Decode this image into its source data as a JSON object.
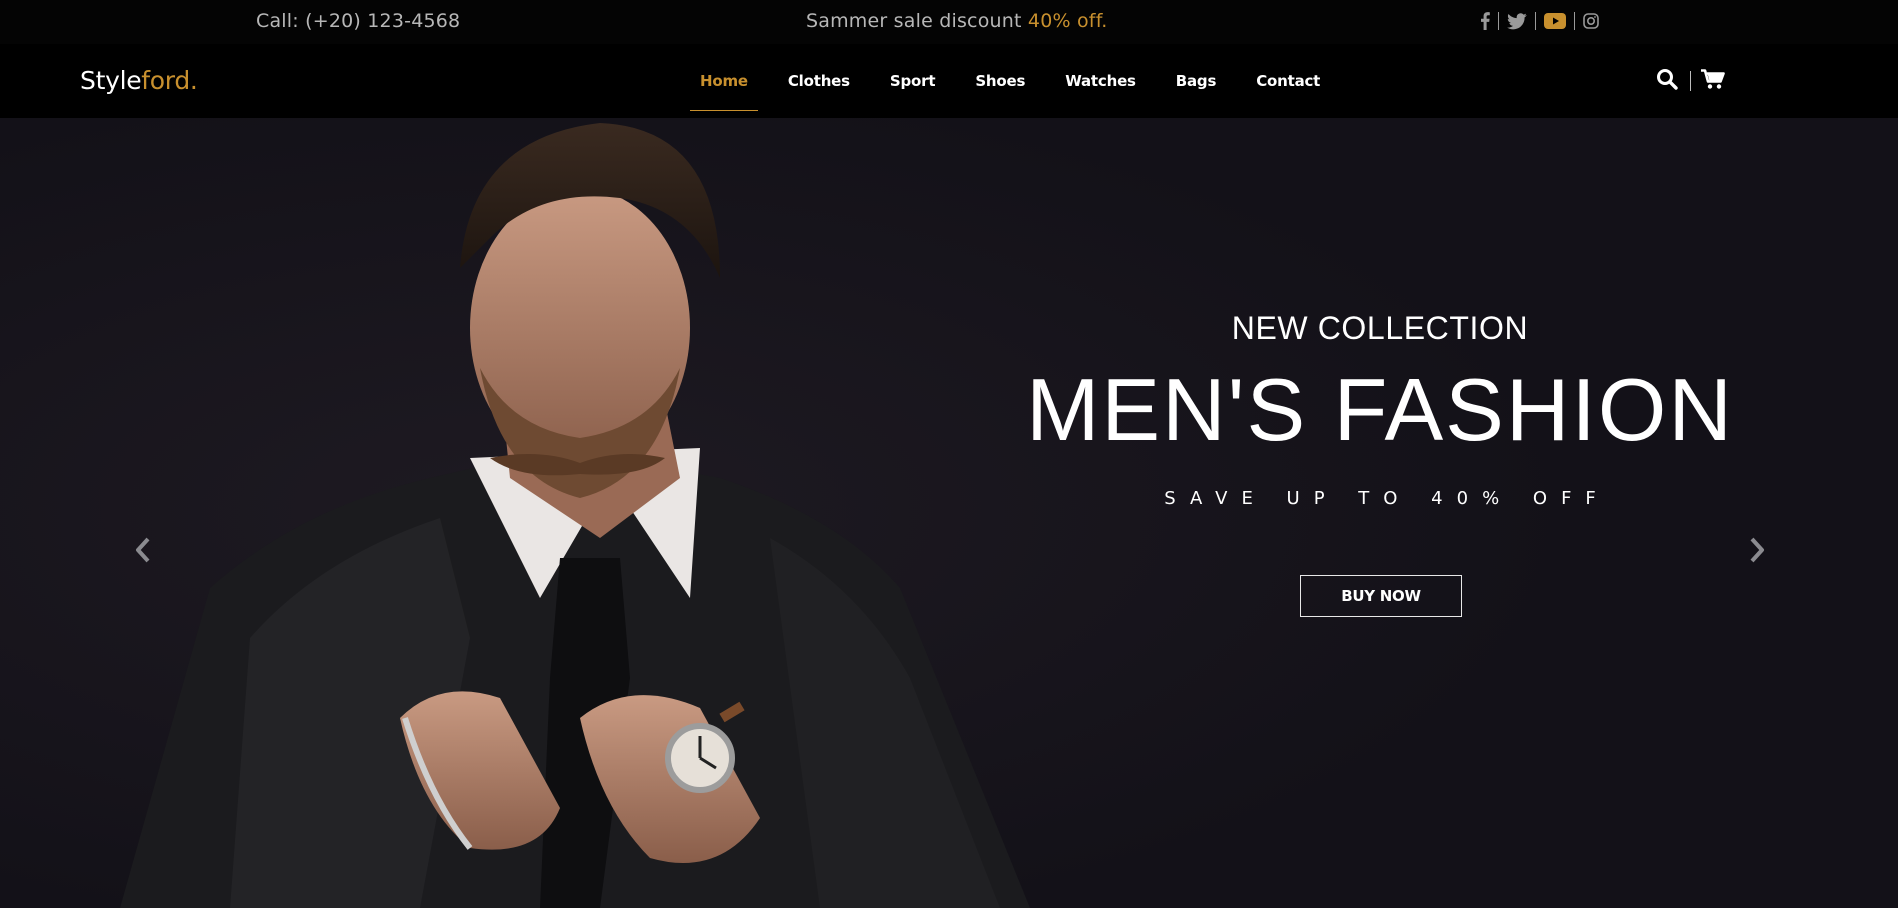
{
  "topbar": {
    "call_label": "Call: (+20) 123-4568",
    "promo_text": "Sammer sale discount ",
    "promo_highlight": "40% off.",
    "social": [
      "facebook-icon",
      "twitter-icon",
      "youtube-icon",
      "instagram-icon"
    ]
  },
  "brand": {
    "logo_main": "Style",
    "logo_accent": "ford."
  },
  "nav": {
    "items": [
      {
        "label": "Home",
        "active": true
      },
      {
        "label": "Clothes"
      },
      {
        "label": "Sport"
      },
      {
        "label": "Shoes"
      },
      {
        "label": "Watches"
      },
      {
        "label": "Bags"
      },
      {
        "label": "Contact"
      }
    ],
    "tools": [
      "search-icon",
      "cart-icon"
    ]
  },
  "hero": {
    "kicker": "NEW COLLECTION",
    "headline": "MEN'S FASHION",
    "sub": "SAVE UP TO 40% OFF",
    "cta_label": "BUY NOW"
  },
  "colors": {
    "accent": "#c8902e",
    "topbar_bg": "#040404",
    "navbar_bg": "#000000",
    "hero_bg": "#15121a"
  }
}
